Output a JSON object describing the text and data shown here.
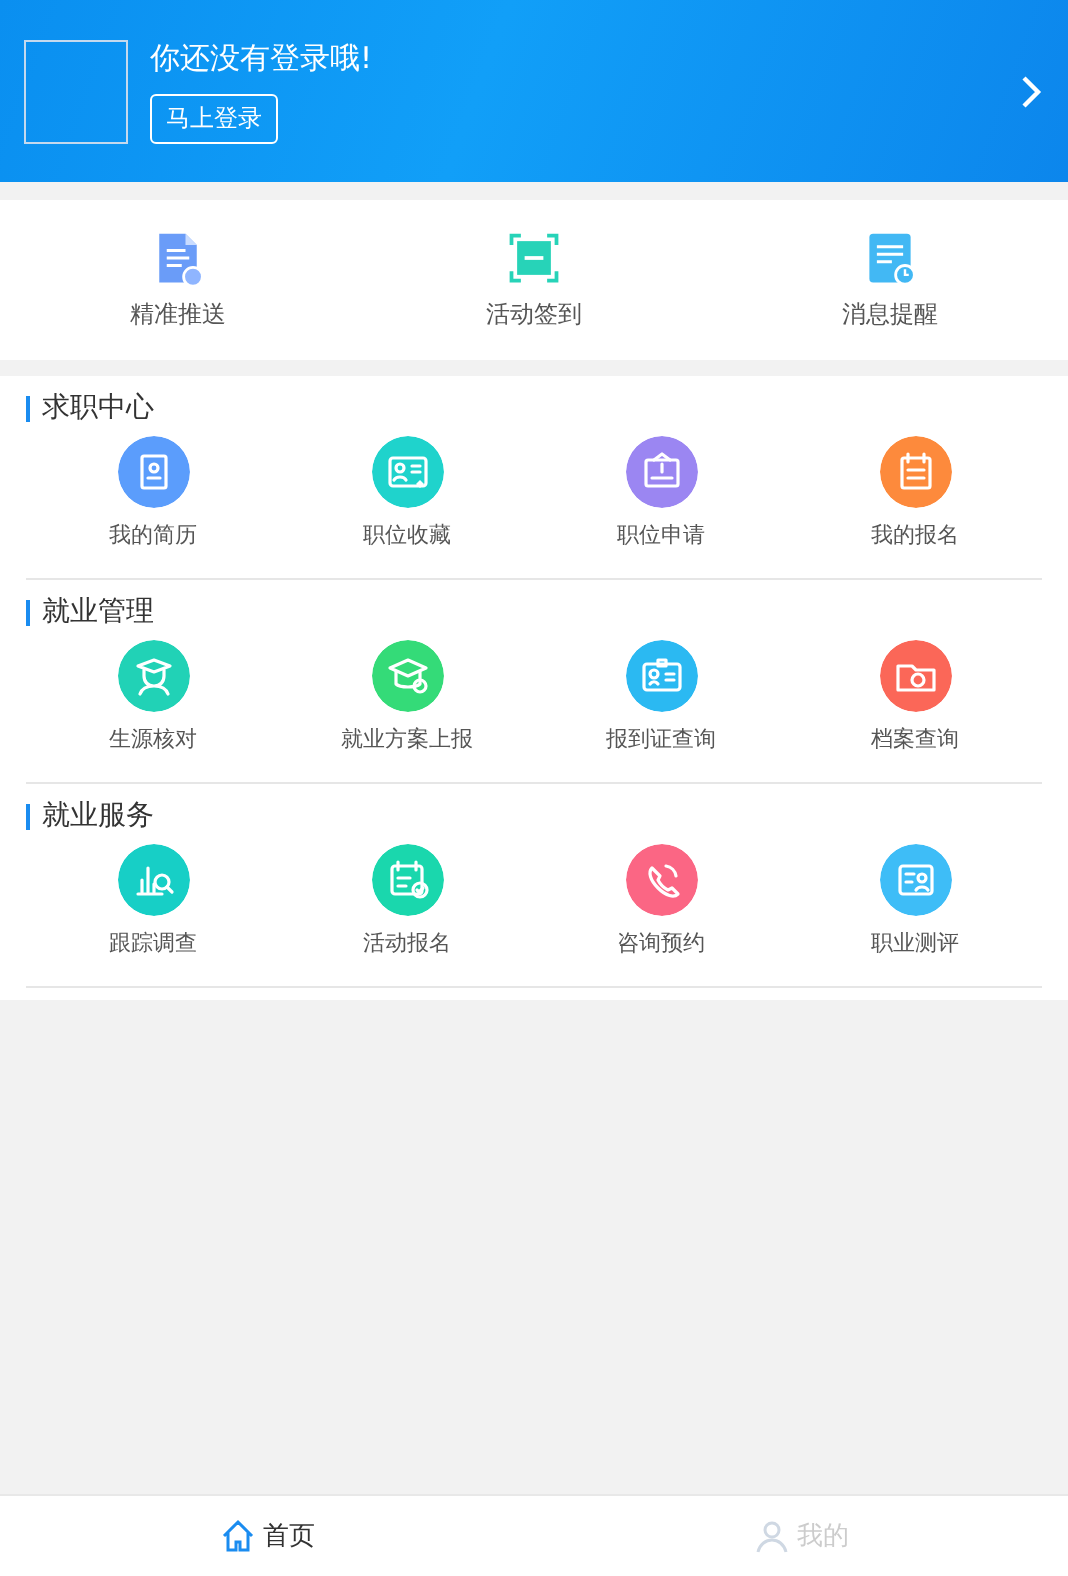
{
  "header": {
    "title": "你还没有登录哦!",
    "login_button": "马上登录"
  },
  "quick_actions": [
    {
      "label": "精准推送"
    },
    {
      "label": "活动签到"
    },
    {
      "label": "消息提醒"
    }
  ],
  "sections": [
    {
      "title": "求职中心",
      "items": [
        {
          "label": "我的简历",
          "color": "#5b9dfc"
        },
        {
          "label": "职位收藏",
          "color": "#1fd3cc"
        },
        {
          "label": "职位申请",
          "color": "#9b86f2"
        },
        {
          "label": "我的报名",
          "color": "#fd8a3c"
        }
      ]
    },
    {
      "title": "就业管理",
      "items": [
        {
          "label": "生源核对",
          "color": "#21d2b6"
        },
        {
          "label": "就业方案上报",
          "color": "#34db78"
        },
        {
          "label": "报到证查询",
          "color": "#2bb9f2"
        },
        {
          "label": "档案查询",
          "color": "#fb6758"
        }
      ]
    },
    {
      "title": "就业服务",
      "items": [
        {
          "label": "跟踪调查",
          "color": "#17cfc6"
        },
        {
          "label": "活动报名",
          "color": "#1ad7ad"
        },
        {
          "label": "咨询预约",
          "color": "#fb6684"
        },
        {
          "label": "职业测评",
          "color": "#3ebdf7"
        }
      ]
    }
  ],
  "bottom_nav": [
    {
      "label": "首页",
      "selected": true
    },
    {
      "label": "我的",
      "selected": false
    }
  ]
}
